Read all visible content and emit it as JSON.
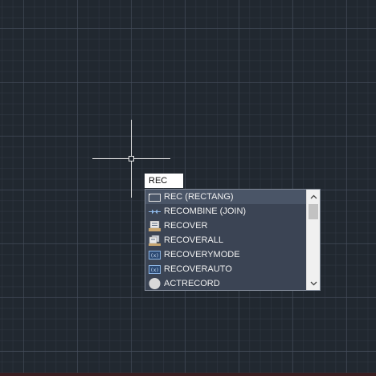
{
  "command_line": {
    "input_value": "REC"
  },
  "autocomplete": {
    "items": [
      {
        "label": "REC (RECTANG)",
        "icon": "rectangle-icon"
      },
      {
        "label": "RECOMBINE (JOIN)",
        "icon": "join-icon"
      },
      {
        "label": "RECOVER",
        "icon": "recover-icon"
      },
      {
        "label": "RECOVERALL",
        "icon": "recover-all-icon"
      },
      {
        "label": "RECOVERYMODE",
        "icon": "system-variable-icon"
      },
      {
        "label": "RECOVERAUTO",
        "icon": "system-variable-icon"
      },
      {
        "label": "ACTRECORD",
        "icon": "record-circle-icon"
      }
    ],
    "selected_index": 0
  },
  "colors": {
    "background": "#212830",
    "popup": "#3b4454",
    "text": "#f0f0f0",
    "crosshair": "#e8e8e8"
  }
}
